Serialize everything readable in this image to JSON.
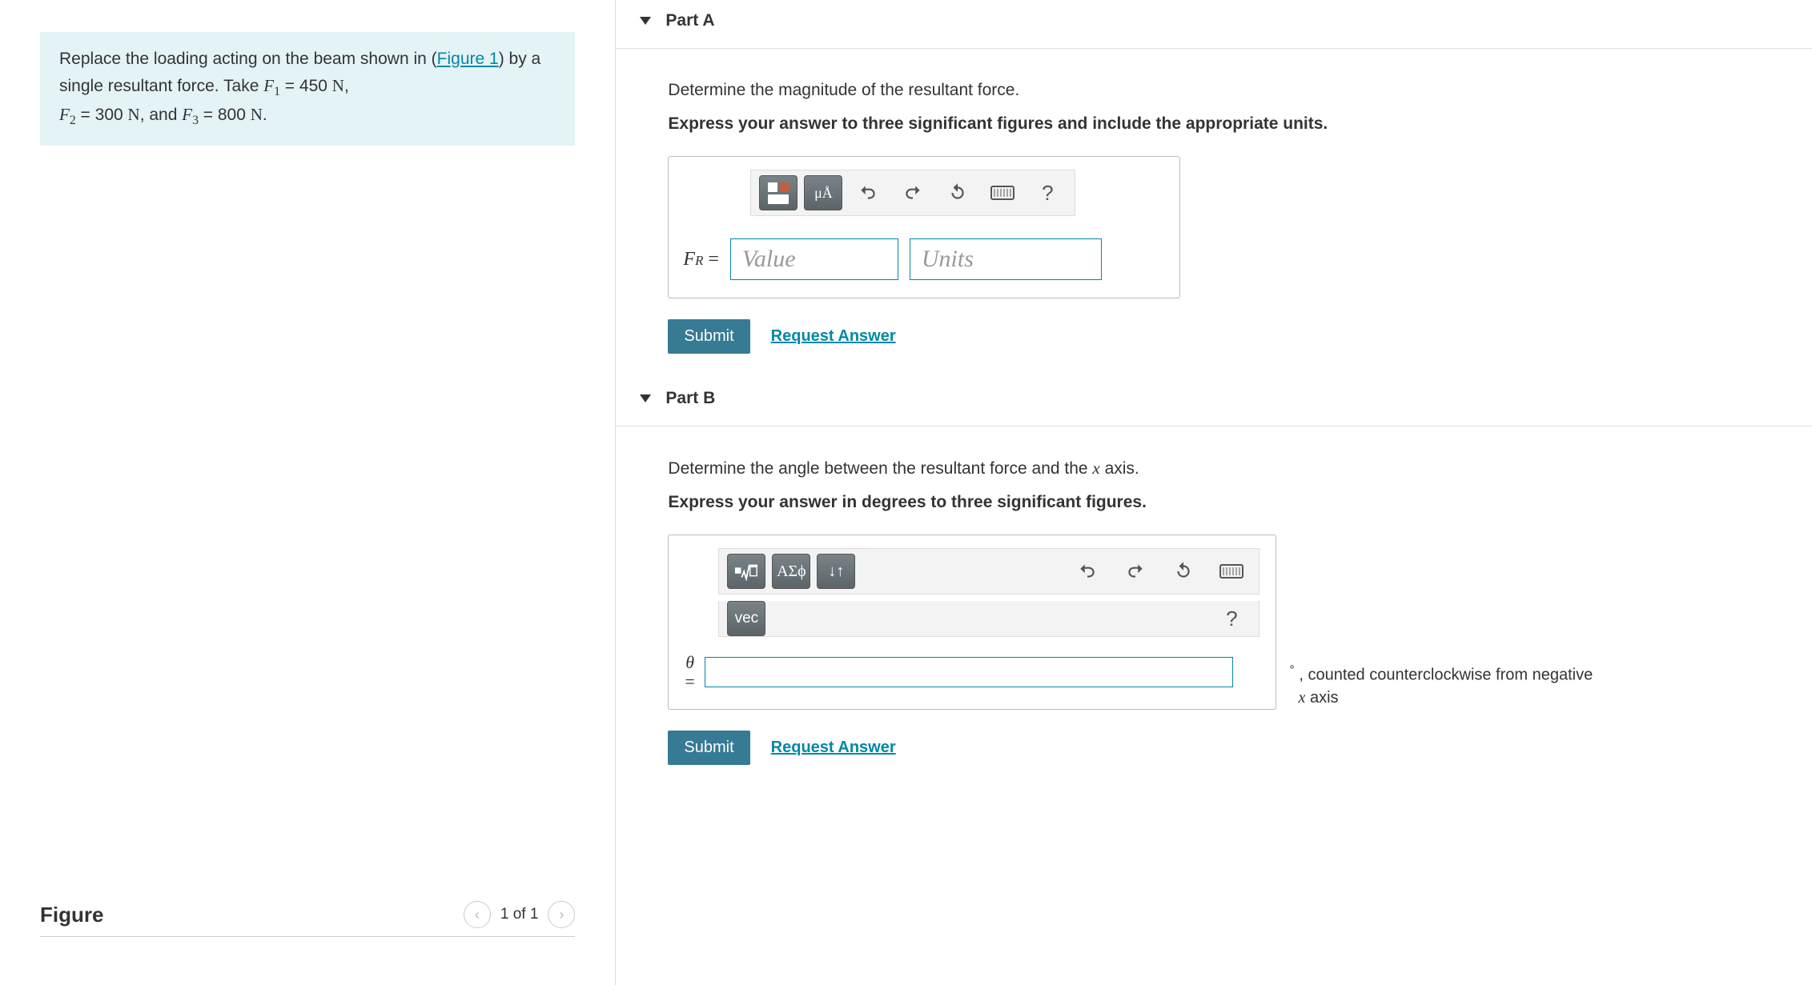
{
  "left": {
    "problem_pre": "Replace the loading acting on the beam shown in (",
    "figure_link": "Figure 1",
    "problem_mid": ") by a single resultant force. Take ",
    "f1_label": "F",
    "f1_sub": "1",
    "f1_val": " = 450 ",
    "f2_label": "F",
    "f2_sub": "2",
    "f2_val": " = 300 ",
    "f3_label": "F",
    "f3_sub": "3",
    "f3_val": " = 800 ",
    "unit_N": "N",
    "figure": {
      "title": "Figure",
      "counter": "1 of 1"
    }
  },
  "partA": {
    "title": "Part A",
    "instr1": "Determine the magnitude of the resultant force.",
    "instr2": "Express your answer to three significant figures and include the appropriate units.",
    "toolbar": {
      "units_btn": "μÅ",
      "help": "?"
    },
    "lhs": "F",
    "lhs_sub": "R",
    "eq": " = ",
    "value_ph": "Value",
    "units_ph": "Units",
    "submit": "Submit",
    "request": "Request Answer"
  },
  "partB": {
    "title": "Part B",
    "instr1_pre": "Determine the angle between the resultant force and the ",
    "instr1_x": "x",
    "instr1_post": " axis.",
    "instr2": "Express your answer in degrees to three significant figures.",
    "toolbar": {
      "greek_btn": "ΑΣϕ",
      "updown": "↓↑",
      "vec": "vec",
      "help": "?"
    },
    "lhs_theta": "θ",
    "lhs_eq": "=",
    "suffix_deg": "°",
    "suffix_pre": " , counted counterclockwise from negative ",
    "suffix_x": "x",
    "suffix_post": " axis",
    "submit": "Submit",
    "request": "Request Answer"
  }
}
